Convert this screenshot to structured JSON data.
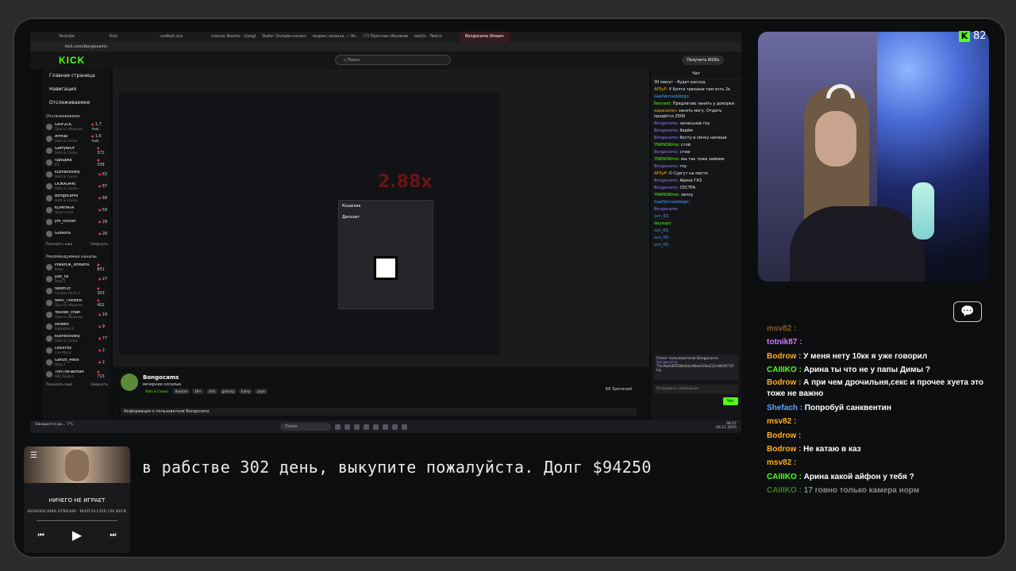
{
  "browser": {
    "tabs": [
      "Youtube",
      "Kick",
      "vodka5.xyz",
      "список Beams - Google",
      "Stake: Онлайн-казино и",
      "яндекс музыка — Ян",
      "(7) Простые объявлен",
      "teo2o - Twitch",
      "Bongocams Stream"
    ],
    "url": "kick.com/bongocams"
  },
  "kick": {
    "logo": "KICK",
    "search_placeholder": "Поиск",
    "get_kicks": "Получить KICKs",
    "nav": [
      "Главная страница",
      "Навигация",
      "Отслеживаемое"
    ],
    "following_header": "Отслеживаемое",
    "following": [
      {
        "name": "GRIFZDC",
        "sub": "Просто общение",
        "viewers": "1,7 тыс."
      },
      {
        "name": "Arthas",
        "sub": "Slots & Casino",
        "viewers": "1,6 тыс."
      },
      {
        "name": "GarryWDF",
        "sub": "Slots & Casino",
        "viewers": "372"
      },
      {
        "name": "Iuplupka",
        "sub": "IRL",
        "viewers": "338"
      },
      {
        "name": "kuznecovsky",
        "sub": "Slots & Casino",
        "viewers": "83"
      },
      {
        "name": "DOKKORKI",
        "sub": "Slots & Casino",
        "viewers": "87"
      },
      {
        "name": "Bongocams",
        "sub": "Slots & Casino",
        "viewers": "68"
      },
      {
        "name": "KOMHATA",
        "sub": "Просто всё",
        "viewers": "59"
      },
      {
        "name": "jim_hunter",
        "sub": "",
        "viewers": "28"
      },
      {
        "name": "Ghostra",
        "sub": "",
        "viewers": "26"
      }
    ],
    "show_more": "Показать еще",
    "collapse": "Свернуть",
    "recommended_header": "Рекомендуемые каналы",
    "recommended": [
      {
        "name": "PokerOK_streams",
        "sub": "Poker",
        "viewers": "851"
      },
      {
        "name": "just_ns",
        "sub": "Dota 2",
        "viewers": "27"
      },
      {
        "name": "Nesm3c",
        "sub": "Counter-Strike 2",
        "viewers": "303"
      },
      {
        "name": "NAVI_TRENER",
        "sub": "Просто общение",
        "viewers": "402"
      },
      {
        "name": "Youtsel_chan",
        "sub": "Просто общение",
        "viewers": "16"
      },
      {
        "name": "ssswev",
        "sub": "Battlefield 6",
        "viewers": "9"
      },
      {
        "name": "kuznecovsky",
        "sub": "Slots & Casino",
        "viewers": "77"
      },
      {
        "name": "DockFox",
        "sub": "Live Music",
        "viewers": "2"
      },
      {
        "name": "Gonzo_Afelv",
        "sub": "Dota 2",
        "viewers": "2"
      },
      {
        "name": "TimTheTatman",
        "sub": "ARC Raiders",
        "viewers": "713"
      }
    ],
    "multiplier": "2.88x",
    "wallet_title": "Кошелек",
    "wallet_deposit": "Депозит",
    "streamer": {
      "name": "Bongocams",
      "title": "вечерние сосалыа",
      "category": "Slots & Casino",
      "tags": [
        "Russian",
        "18+",
        "chill",
        "gaming",
        "funny",
        "pups"
      ],
      "viewers": "68 Зрителей",
      "info": "Информация о пользователе Bongocams"
    },
    "chat_header": "Чат",
    "chat": [
      {
        "user": "",
        "text": "30 минут - будет расход",
        "c": ""
      },
      {
        "user": "APЗуР:",
        "text": "У Болта трюхани там есть 2к",
        "c": "o"
      },
      {
        "user": "GaelVernadskogo:",
        "text": "",
        "c": "b"
      },
      {
        "user": "Nervwst:",
        "text": "Предлагаю занять у докорки",
        "c": "g"
      },
      {
        "user": "хараcапон:",
        "text": "занять могу. Отдать придётся 2500",
        "c": "o"
      },
      {
        "user": "Bongocams:",
        "text": "запасцнов гоу",
        "c": ""
      },
      {
        "user": "Bongocams:",
        "text": "берём",
        "c": ""
      },
      {
        "user": "Bongocams:",
        "text": "болту в личку напиши",
        "c": ""
      },
      {
        "user": "YNKNOWme:",
        "text": "стой",
        "c": "g"
      },
      {
        "user": "Bongocams:",
        "text": "стою",
        "c": ""
      },
      {
        "user": "YNKNOWme:",
        "text": "мы так тоже займем",
        "c": "g"
      },
      {
        "user": "Bongocams:",
        "text": "гоу",
        "c": ""
      },
      {
        "user": "APЗуР:",
        "text": "О Сургут на месте",
        "c": "o"
      },
      {
        "user": "Bongocams:",
        "text": "Арина ГАЗ",
        "c": ""
      },
      {
        "user": "Bongocams:",
        "text": "СЕСТРА",
        "c": ""
      },
      {
        "user": "YNKNOWme:",
        "text": "личку",
        "c": "g"
      },
      {
        "user": "GaelVernadskogo:",
        "text": "",
        "c": "b"
      },
      {
        "user": "Bongocams:",
        "text": "",
        "c": ""
      },
      {
        "user": "svn_03:",
        "text": "",
        "c": "b"
      },
      {
        "user": "daysupz:",
        "text": "",
        "c": "g"
      },
      {
        "user": "svn_03:",
        "text": "",
        "c": "b"
      },
      {
        "user": "svn_03:",
        "text": "",
        "c": "b"
      },
      {
        "user": "svn_03:",
        "text": "",
        "c": "b"
      }
    ],
    "reply_to": "Ответ пользователю Bongocams:",
    "reply_user": "Bongocams:",
    "reply_text": "TXcAwG8fZ5Wz0dxABwGVRoZ22nWD6TVZhq",
    "chat_placeholder": "Отправить сообщение",
    "chat_button": "Чат"
  },
  "taskbar": {
    "weather": "Ожидается до... 7°C",
    "search": "Поиск",
    "time": "06:57",
    "date": "04.11.2025"
  },
  "overlay": {
    "cam_count": "82",
    "ticker": "в рабстве 302 день, выкупите пожалуйста. Долг $94250",
    "music_status": "НИЧЕГО НЕ ИГРАЕТ",
    "music_track": "BONGOCAMS STREAM - WATCH LIVE ON KICK",
    "chat": [
      {
        "user": "msv82 :",
        "text": "",
        "c": "",
        "fade": true
      },
      {
        "user": "totnik87 :",
        "text": "",
        "c": "p"
      },
      {
        "user": "Bodrow :",
        "text": "У меня нету 10кк я уже говорил",
        "c": ""
      },
      {
        "user": "CAIIIKO :",
        "text": "Арина ты что не у папы Димы ?",
        "c": "g"
      },
      {
        "user": "Bodrow :",
        "text": "А при чем дрочильня,секс и прочее хуета это тоже не важно",
        "c": "",
        "wrap": true
      },
      {
        "user": "Shefach :",
        "text": "Попробуй санквентин",
        "c": "bl"
      },
      {
        "user": "msv82 :",
        "text": "",
        "c": ""
      },
      {
        "user": "Bodrow :",
        "text": "",
        "c": ""
      },
      {
        "user": "Bodrow :",
        "text": "Не катаю в каз",
        "c": ""
      },
      {
        "user": "msv82 :",
        "text": "",
        "c": ""
      },
      {
        "user": "CAIIIKO :",
        "text": "Арина какой айфон у тебя ?",
        "c": "g"
      },
      {
        "user": "CAIIIKO :",
        "text": "17 говно только камера норм",
        "c": "g",
        "fade": true
      }
    ]
  }
}
